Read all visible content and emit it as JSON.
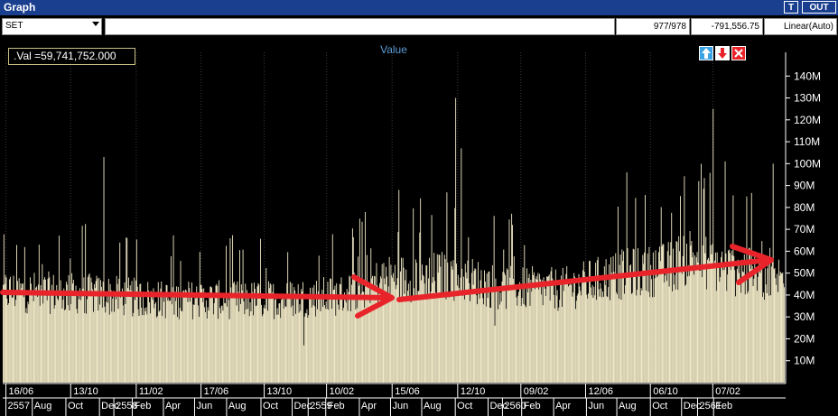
{
  "window": {
    "title": "Graph",
    "btn_t": "T",
    "btn_out": "OUT"
  },
  "toolbar": {
    "symbol": "SET",
    "position": "977/978",
    "coordinate": "-791,556.75",
    "scale": "Linear(Auto)"
  },
  "value_label": ".Val   =59,741,752.000",
  "colors": {
    "bars": "#f1e9c7",
    "arrow": "#e8242a",
    "axis_text": "#ffffff",
    "title_blue": "#1a3f8f",
    "series_label": "#5b9bd5"
  },
  "icons": [
    "up-arrow-icon",
    "down-arrow-icon",
    "close-icon"
  ],
  "chart_data": {
    "type": "bar",
    "series": [
      {
        "name": "Value"
      }
    ],
    "ylim": [
      0,
      150000000
    ],
    "yticks": [
      {
        "value": 10000000,
        "label": "10M"
      },
      {
        "value": 20000000,
        "label": "20M"
      },
      {
        "value": 30000000,
        "label": "30M"
      },
      {
        "value": 40000000,
        "label": "40M"
      },
      {
        "value": 50000000,
        "label": "50M"
      },
      {
        "value": 60000000,
        "label": "60M"
      },
      {
        "value": 70000000,
        "label": "70M"
      },
      {
        "value": 80000000,
        "label": "80M"
      },
      {
        "value": 90000000,
        "label": "90M"
      },
      {
        "value": 100000000,
        "label": "100M"
      },
      {
        "value": 110000000,
        "label": "110M"
      },
      {
        "value": 120000000,
        "label": "120M"
      },
      {
        "value": 130000000,
        "label": "130M"
      },
      {
        "value": 140000000,
        "label": "140M"
      }
    ],
    "xlim": [
      0,
      978
    ],
    "x_top_labels": [
      {
        "index": 4,
        "label": "16/06"
      },
      {
        "index": 85,
        "label": "13/10"
      },
      {
        "index": 167,
        "label": "11/02"
      },
      {
        "index": 248,
        "label": "17/06"
      },
      {
        "index": 327,
        "label": "13/10"
      },
      {
        "index": 405,
        "label": "10/02"
      },
      {
        "index": 487,
        "label": "15/06"
      },
      {
        "index": 569,
        "label": "12/10"
      },
      {
        "index": 648,
        "label": "09/02"
      },
      {
        "index": 729,
        "label": "12/06"
      },
      {
        "index": 810,
        "label": "06/10"
      },
      {
        "index": 888,
        "label": "07/02"
      }
    ],
    "x_bottom_labels": [
      {
        "index": 4,
        "label": "2557"
      },
      {
        "index": 37,
        "label": "Aug"
      },
      {
        "index": 79,
        "label": "Oct"
      },
      {
        "index": 121,
        "label": "Dec"
      },
      {
        "index": 139,
        "label": "2558"
      },
      {
        "index": 162,
        "label": "Feb"
      },
      {
        "index": 201,
        "label": "Apr"
      },
      {
        "index": 240,
        "label": "Jun"
      },
      {
        "index": 280,
        "label": "Aug"
      },
      {
        "index": 323,
        "label": "Oct"
      },
      {
        "index": 362,
        "label": "Dec"
      },
      {
        "index": 382,
        "label": "2559"
      },
      {
        "index": 404,
        "label": "Feb"
      },
      {
        "index": 446,
        "label": "Apr"
      },
      {
        "index": 485,
        "label": "Jun"
      },
      {
        "index": 524,
        "label": "Aug"
      },
      {
        "index": 566,
        "label": "Oct"
      },
      {
        "index": 607,
        "label": "Dec"
      },
      {
        "index": 625,
        "label": "2560"
      },
      {
        "index": 649,
        "label": "Feb"
      },
      {
        "index": 689,
        "label": "Apr"
      },
      {
        "index": 730,
        "label": "Jun"
      },
      {
        "index": 768,
        "label": "Aug"
      },
      {
        "index": 810,
        "label": "Oct"
      },
      {
        "index": 849,
        "label": "Dec"
      },
      {
        "index": 869,
        "label": "2561"
      },
      {
        "index": 889,
        "label": "Feb"
      }
    ],
    "level_profile": [
      [
        0,
        44000000
      ],
      [
        100,
        43000000
      ],
      [
        200,
        40000000
      ],
      [
        330,
        40000000
      ],
      [
        420,
        42000000
      ],
      [
        480,
        50000000
      ],
      [
        560,
        52000000
      ],
      [
        620,
        46000000
      ],
      [
        700,
        45000000
      ],
      [
        770,
        52000000
      ],
      [
        830,
        55000000
      ],
      [
        860,
        62000000
      ],
      [
        900,
        55000000
      ],
      [
        978,
        50000000
      ]
    ],
    "peaks": [
      {
        "index": 126,
        "value": 103000000
      },
      {
        "index": 566,
        "value": 130000000
      },
      {
        "index": 573,
        "value": 107000000
      },
      {
        "index": 495,
        "value": 88000000
      },
      {
        "index": 780,
        "value": 96000000
      },
      {
        "index": 888,
        "value": 125000000
      },
      {
        "index": 870,
        "value": 92000000
      },
      {
        "index": 903,
        "value": 101000000
      },
      {
        "index": 963,
        "value": 100000000
      },
      {
        "index": 930,
        "value": 85000000
      },
      {
        "index": 376,
        "value": 17000000
      },
      {
        "index": 615,
        "value": 26000000
      }
    ],
    "annotation": "trend arrows"
  }
}
